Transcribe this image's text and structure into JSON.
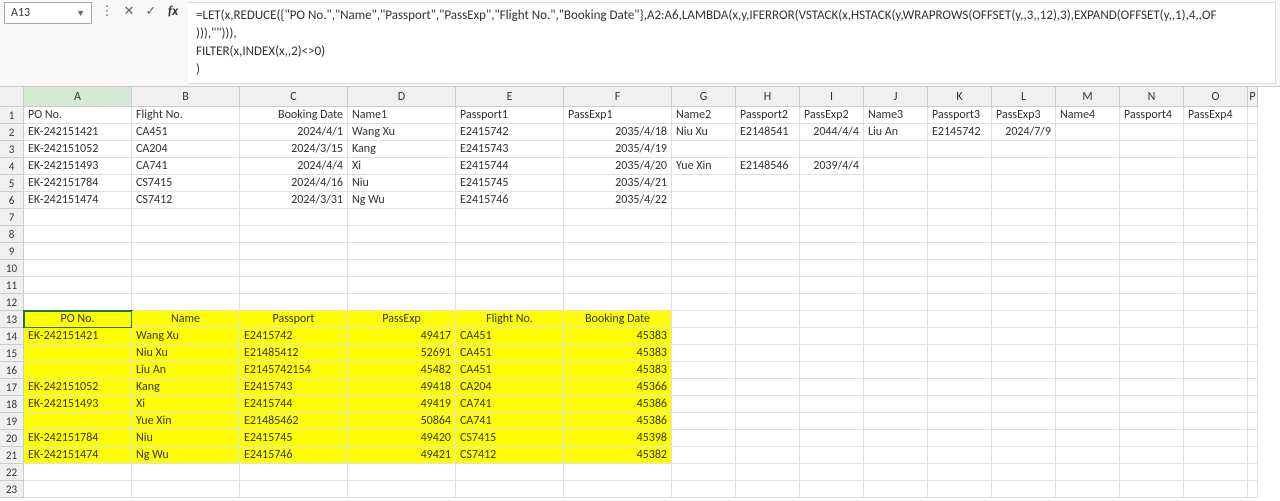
{
  "formula_bar": {
    "name_box": "A13",
    "formula": "=LET(x,REDUCE({\"PO No.\",\"Name\",\"Passport\",\"PassExp\",\"Flight No.\",\"Booking Date\"},A2:A6,LAMBDA(x,y,IFERROR(VSTACK(x,HSTACK(y,WRAPROWS(OFFSET(y,,3,,12),3),EXPAND(OFFSET(y,,1),4,,OF\n))),\"\"))),\nFILTER(x,INDEX(x,,2)<>0)\n)"
  },
  "columns": [
    "A",
    "B",
    "C",
    "D",
    "E",
    "F",
    "G",
    "H",
    "I",
    "J",
    "K",
    "L",
    "M",
    "N",
    "O",
    "P"
  ],
  "selected_col": "A",
  "selected_cell": "A13",
  "headers1": {
    "A": "PO No.",
    "B": "Flight No.",
    "C": "Booking Date",
    "D": "Name1",
    "E": "Passport1",
    "F": "PassExp1",
    "G": "Name2",
    "H": "Passport2",
    "I": "PassExp2",
    "J": "Name3",
    "K": "Passport3",
    "L": "PassExp3",
    "M": "Name4",
    "N": "Passport4",
    "O": "PassExp4"
  },
  "data_top": [
    {
      "A": "EK-242151421",
      "B": "CA451",
      "C": "2024/4/1",
      "D": "Wang Xu",
      "E": "E2415742",
      "F": "2035/4/18",
      "G": "Niu Xu",
      "H": "E2148541",
      "I": "2044/4/4",
      "J": "Liu An",
      "K": "E2145742",
      "L": "2024/7/9"
    },
    {
      "A": "EK-242151052",
      "B": "CA204",
      "C": "2024/3/15",
      "D": "Kang",
      "E": "E2415743",
      "F": "2035/4/19"
    },
    {
      "A": "EK-242151493",
      "B": "CA741",
      "C": "2024/4/4",
      "D": "Xi",
      "E": "E2415744",
      "F": "2035/4/20",
      "G": "Yue Xin",
      "H": "E2148546",
      "I": "2039/4/4"
    },
    {
      "A": "EK-242151784",
      "B": "CS7415",
      "C": "2024/4/16",
      "D": "Niu",
      "E": "E2415745",
      "F": "2035/4/21"
    },
    {
      "A": "EK-242151474",
      "B": "CS7412",
      "C": "2024/3/31",
      "D": "Ng Wu",
      "E": "E2415746",
      "F": "2035/4/22"
    }
  ],
  "headers2": {
    "A": "PO No.",
    "B": "Name",
    "C": "Passport",
    "D": "PassExp",
    "E": "Flight No.",
    "F": "Booking Date"
  },
  "data_bottom": [
    {
      "A": "EK-242151421",
      "B": "Wang Xu",
      "C": "E2415742",
      "D": "49417",
      "E": "CA451",
      "F": "45383"
    },
    {
      "A": "",
      "B": "Niu Xu",
      "C": "E21485412",
      "D": "52691",
      "E": "CA451",
      "F": "45383"
    },
    {
      "A": "",
      "B": "Liu An",
      "C": "E2145742154",
      "D": "45482",
      "E": "CA451",
      "F": "45383"
    },
    {
      "A": "EK-242151052",
      "B": "Kang",
      "C": "E2415743",
      "D": "49418",
      "E": "CA204",
      "F": "45366"
    },
    {
      "A": "EK-242151493",
      "B": "Xi",
      "C": "E2415744",
      "D": "49419",
      "E": "CA741",
      "F": "45386"
    },
    {
      "A": "",
      "B": "Yue Xin",
      "C": "E21485462",
      "D": "50864",
      "E": "CA741",
      "F": "45386"
    },
    {
      "A": "EK-242151784",
      "B": "Niu",
      "C": "E2415745",
      "D": "49420",
      "E": "CS7415",
      "F": "45398"
    },
    {
      "A": "EK-242151474",
      "B": "Ng Wu",
      "C": "E2415746",
      "D": "49421",
      "E": "CS7412",
      "F": "45382"
    }
  ],
  "chart_data": {
    "type": "table",
    "title": "Flight Booking Records",
    "source_table": {
      "columns": [
        "PO No.",
        "Flight No.",
        "Booking Date",
        "Name1",
        "Passport1",
        "PassExp1",
        "Name2",
        "Passport2",
        "PassExp2",
        "Name3",
        "Passport3",
        "PassExp3",
        "Name4",
        "Passport4",
        "PassExp4"
      ],
      "rows": [
        [
          "EK-242151421",
          "CA451",
          "2024/4/1",
          "Wang Xu",
          "E2415742",
          "2035/4/18",
          "Niu Xu",
          "E2148541",
          "2044/4/4",
          "Liu An",
          "E2145742",
          "2024/7/9",
          "",
          "",
          ""
        ],
        [
          "EK-242151052",
          "CA204",
          "2024/3/15",
          "Kang",
          "E2415743",
          "2035/4/19",
          "",
          "",
          "",
          "",
          "",
          "",
          "",
          "",
          ""
        ],
        [
          "EK-242151493",
          "CA741",
          "2024/4/4",
          "Xi",
          "E2415744",
          "2035/4/20",
          "Yue Xin",
          "E2148546",
          "2039/4/4",
          "",
          "",
          "",
          "",
          "",
          ""
        ],
        [
          "EK-242151784",
          "CS7415",
          "2024/4/16",
          "Niu",
          "E2415745",
          "2035/4/21",
          "",
          "",
          "",
          "",
          "",
          "",
          "",
          "",
          ""
        ],
        [
          "EK-242151474",
          "CS7412",
          "2024/3/31",
          "Ng Wu",
          "E2415746",
          "2035/4/22",
          "",
          "",
          "",
          "",
          "",
          "",
          "",
          "",
          ""
        ]
      ]
    },
    "result_table": {
      "columns": [
        "PO No.",
        "Name",
        "Passport",
        "PassExp",
        "Flight No.",
        "Booking Date"
      ],
      "rows": [
        [
          "EK-242151421",
          "Wang Xu",
          "E2415742",
          49417,
          "CA451",
          45383
        ],
        [
          "",
          "Niu Xu",
          "E21485412",
          52691,
          "CA451",
          45383
        ],
        [
          "",
          "Liu An",
          "E2145742154",
          45482,
          "CA451",
          45383
        ],
        [
          "EK-242151052",
          "Kang",
          "E2415743",
          49418,
          "CA204",
          45366
        ],
        [
          "EK-242151493",
          "Xi",
          "E2415744",
          49419,
          "CA741",
          45386
        ],
        [
          "",
          "Yue Xin",
          "E21485462",
          50864,
          "CA741",
          45386
        ],
        [
          "EK-242151784",
          "Niu",
          "E2415745",
          49420,
          "CS7415",
          45398
        ],
        [
          "EK-242151474",
          "Ng Wu",
          "E2415746",
          49421,
          "CS7412",
          45382
        ]
      ]
    }
  }
}
